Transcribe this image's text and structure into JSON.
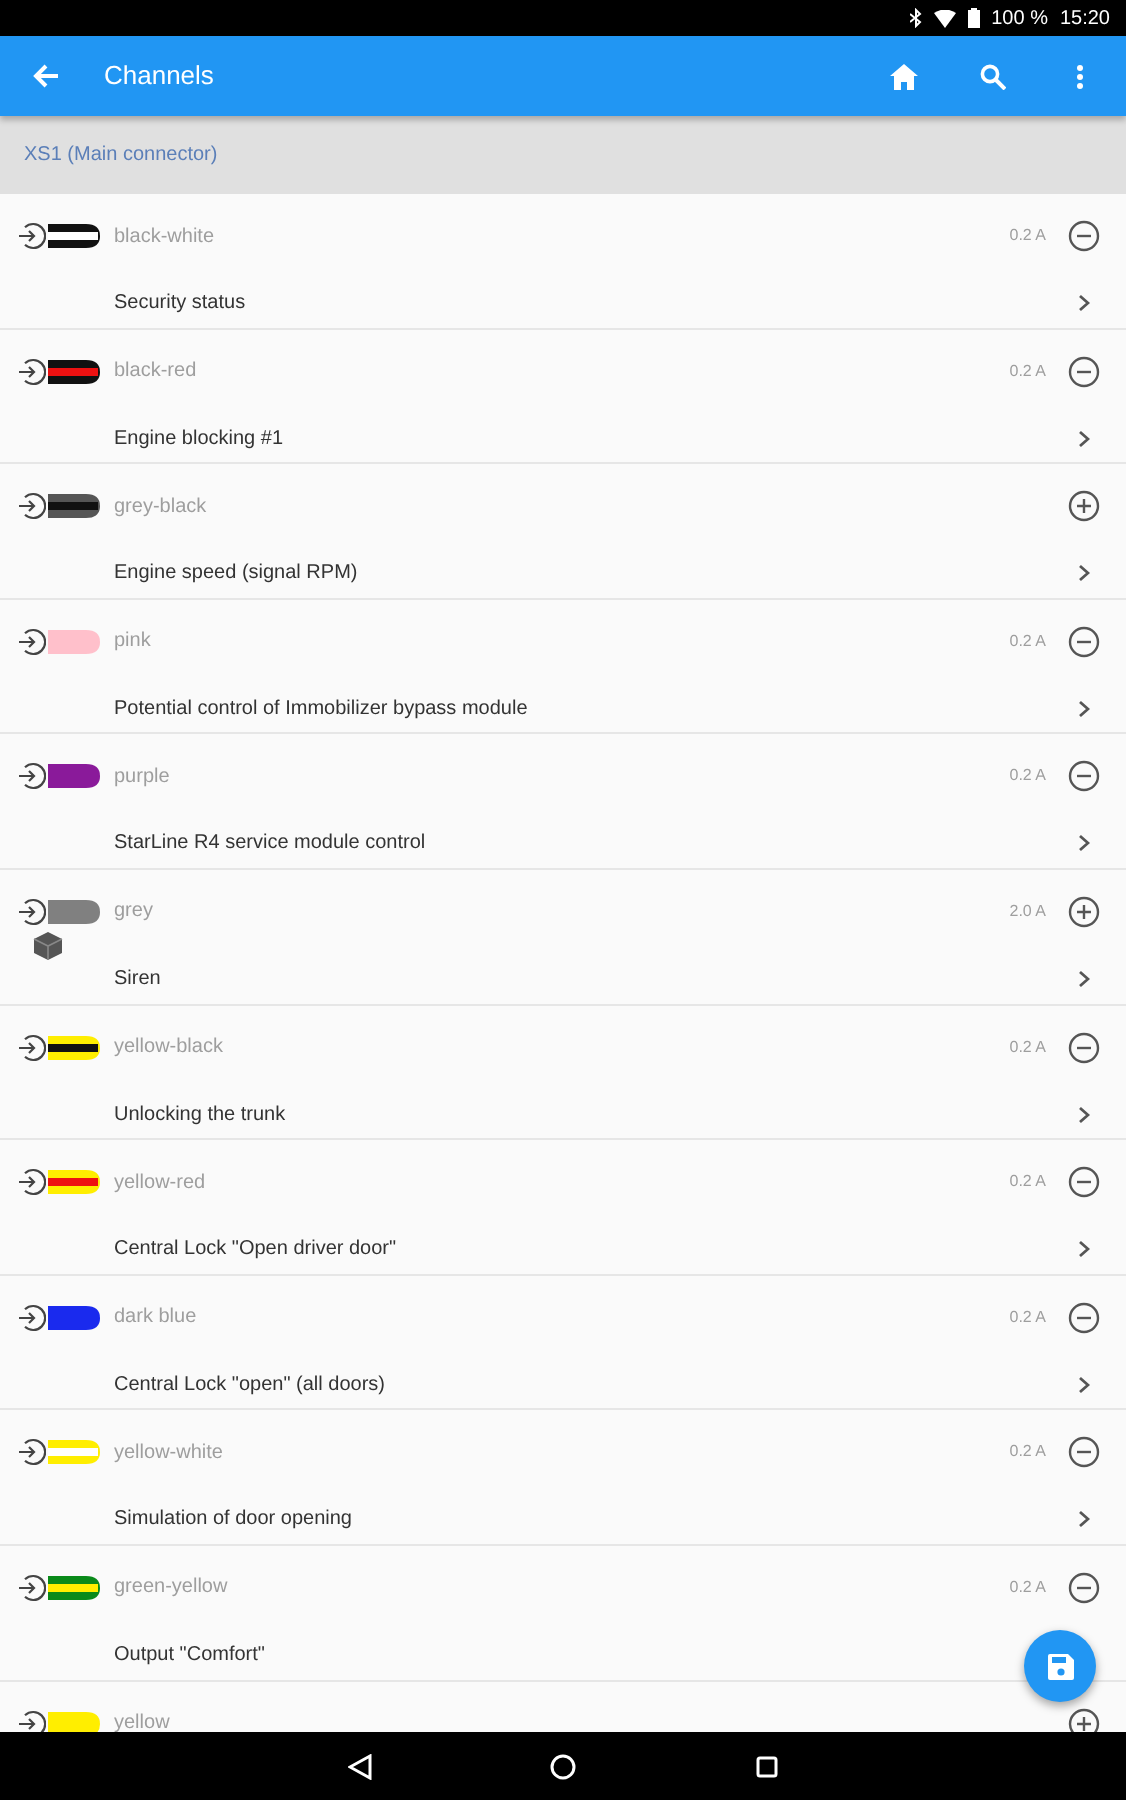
{
  "status_bar": {
    "battery": "100 %",
    "time": "15:20"
  },
  "app_bar": {
    "title": "Channels"
  },
  "section": {
    "title": "XS1 (Main connector)"
  },
  "channels": [
    {
      "wire": "black-white",
      "wire_colors": [
        {
          "color": "#111111"
        },
        {
          "color": "#ffffff"
        }
      ],
      "current": "0.2 A",
      "enabled": true,
      "function": "Security status"
    },
    {
      "wire": "black-red",
      "wire_colors": [
        {
          "color": "#111111"
        },
        {
          "color": "#ee1111"
        }
      ],
      "current": "0.2 A",
      "enabled": true,
      "function": "Engine blocking #1"
    },
    {
      "wire": "grey-black",
      "wire_colors": [
        {
          "color": "#555555"
        },
        {
          "color": "#111111"
        }
      ],
      "enabled": false,
      "function": "Engine speed (signal RPM)"
    },
    {
      "wire": "pink",
      "wire_colors": [
        {
          "color": "#ffc0cb"
        }
      ],
      "current": "0.2 A",
      "enabled": true,
      "function": "Potential control of Immobilizer bypass module"
    },
    {
      "wire": "purple",
      "wire_colors": [
        {
          "color": "#8a1a9a"
        }
      ],
      "current": "0.2 A",
      "enabled": true,
      "function": "StarLine R4 service module control"
    },
    {
      "wire": "grey",
      "wire_colors": [
        {
          "color": "#808080"
        }
      ],
      "current": "2.0 A",
      "enabled": false,
      "function": "Siren",
      "has_device": true
    },
    {
      "wire": "yellow-black",
      "wire_colors": [
        {
          "color": "#ffee00"
        },
        {
          "color": "#111111"
        }
      ],
      "current": "0.2 A",
      "enabled": true,
      "function": "Unlocking the trunk"
    },
    {
      "wire": "yellow-red",
      "wire_colors": [
        {
          "color": "#ffee00"
        },
        {
          "color": "#ee1111"
        }
      ],
      "current": "0.2 A",
      "enabled": true,
      "function": "Central Lock \"Open driver door\""
    },
    {
      "wire": "dark blue",
      "wire_colors": [
        {
          "color": "#1a2aee"
        }
      ],
      "current": "0.2 A",
      "enabled": true,
      "function": "Central Lock \"open\" (all doors)"
    },
    {
      "wire": "yellow-white",
      "wire_colors": [
        {
          "color": "#ffee00"
        },
        {
          "color": "#ffffff"
        }
      ],
      "current": "0.2 A",
      "enabled": true,
      "function": "Simulation of door opening"
    },
    {
      "wire": "green-yellow",
      "wire_colors": [
        {
          "color": "#0a8a1a"
        },
        {
          "color": "#ffee00"
        }
      ],
      "current": "0.2 A",
      "enabled": true,
      "function": "Output \"Comfort\"",
      "chevron_covered": true
    },
    {
      "wire": "yellow",
      "wire_colors": [
        {
          "color": "#ffee00"
        }
      ],
      "enabled": false
    }
  ]
}
